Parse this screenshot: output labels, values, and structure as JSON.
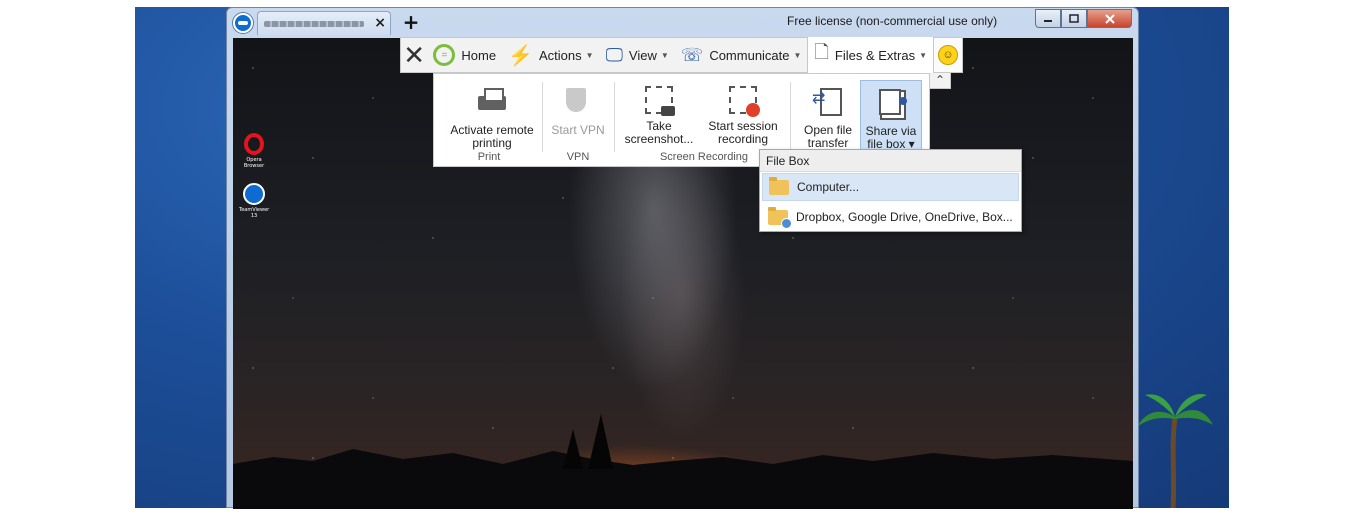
{
  "window": {
    "license_text": "Free license (non-commercial use only)",
    "new_tab_label": "+",
    "tab_close": "×"
  },
  "desktop": {
    "icons": [
      {
        "label": "Opera Browser",
        "icon": "opera-icon"
      },
      {
        "label": "TeamViewer 13",
        "icon": "teamviewer-icon"
      }
    ]
  },
  "toolbar": {
    "close_glyph": "✕",
    "home": "Home",
    "actions": "Actions",
    "view": "View",
    "communicate": "Communicate",
    "files_extras": "Files & Extras",
    "dropdown_arrow": "▼",
    "collapse_glyph": "⌃"
  },
  "ribbon": {
    "activate_printing": "Activate remote printing",
    "start_vpn": "Start VPN",
    "take_screenshot": "Take screenshot...",
    "start_recording": "Start session recording",
    "open_file_transfer": "Open file transfer",
    "share_file_box": "Share via file box",
    "share_arrow": "▾",
    "groups": {
      "print": "Print",
      "vpn": "VPN",
      "screen_recording": "Screen Recording"
    }
  },
  "filebox_menu": {
    "header": "File Box",
    "items": [
      "Computer...",
      "Dropbox, Google Drive, OneDrive, Box..."
    ]
  },
  "colors": {
    "desktop_blue": "#1d4f9a",
    "teamviewer_blue": "#0e6bd1",
    "ribbon_highlight": "#cde0f5",
    "close_red": "#c8442b"
  }
}
